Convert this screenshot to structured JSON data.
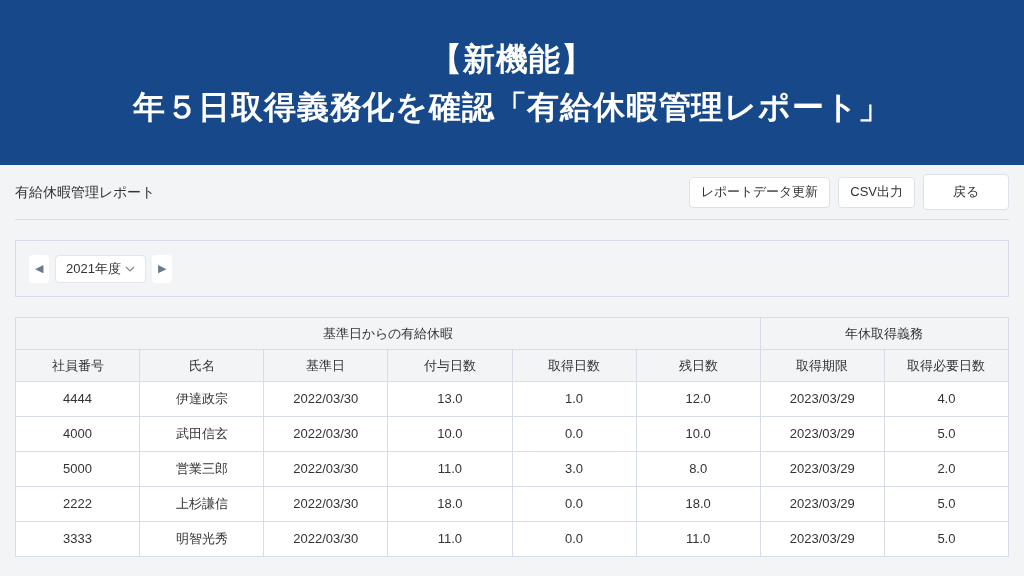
{
  "banner": {
    "lines": [
      "【新機能】",
      "年５日取得義務化を確認「有給休暇管理レポート」"
    ]
  },
  "page": {
    "title": "有給休暇管理レポート",
    "buttons": [
      "レポートデータ更新",
      "CSV出力",
      "戻る"
    ]
  },
  "filter": {
    "prev": "◀",
    "year": "2021年度",
    "next": "▶"
  },
  "table": {
    "groups": [
      {
        "label": "基準日からの有給休暇",
        "columns": [
          "社員番号",
          "氏名",
          "基準日",
          "付与日数",
          "取得日数",
          "残日数"
        ]
      },
      {
        "label": "年休取得義務",
        "columns": [
          "取得期限",
          "取得必要日数"
        ]
      }
    ],
    "rows": [
      [
        "4444",
        "伊達政宗",
        "2022/03/30",
        "13.0",
        "1.0",
        "12.0",
        "2023/03/29",
        "4.0"
      ],
      [
        "4000",
        "武田信玄",
        "2022/03/30",
        "10.0",
        "0.0",
        "10.0",
        "2023/03/29",
        "5.0"
      ],
      [
        "5000",
        "営業三郎",
        "2022/03/30",
        "11.0",
        "3.0",
        "8.0",
        "2023/03/29",
        "2.0"
      ],
      [
        "2222",
        "上杉謙信",
        "2022/03/30",
        "18.0",
        "0.0",
        "18.0",
        "2023/03/29",
        "5.0"
      ],
      [
        "3333",
        "明智光秀",
        "2022/03/30",
        "11.0",
        "0.0",
        "11.0",
        "2023/03/29",
        "5.0"
      ]
    ]
  }
}
